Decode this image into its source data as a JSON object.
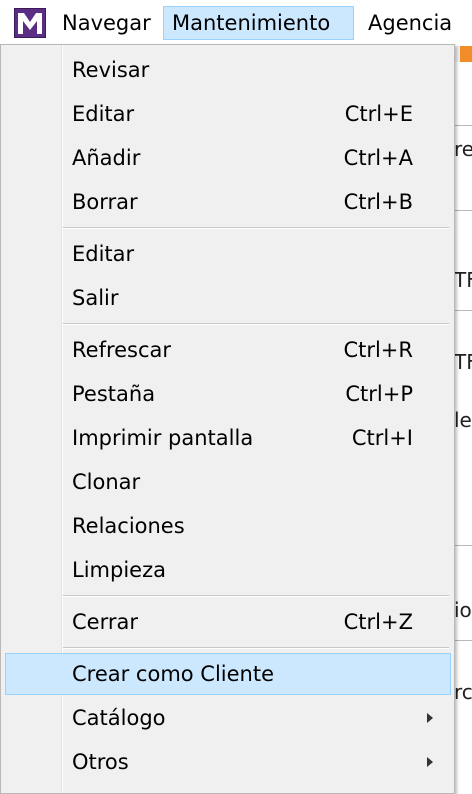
{
  "menubar": {
    "items": [
      {
        "label": "Navegar"
      },
      {
        "label": "Mantenimiento"
      },
      {
        "label": "Agencia"
      }
    ]
  },
  "dropdown": {
    "groups": [
      [
        {
          "label": "Revisar",
          "shortcut": ""
        },
        {
          "label": "Editar",
          "shortcut": "Ctrl+E"
        },
        {
          "label": "Añadir",
          "shortcut": "Ctrl+A"
        },
        {
          "label": "Borrar",
          "shortcut": "Ctrl+B"
        }
      ],
      [
        {
          "label": "Editar",
          "shortcut": ""
        },
        {
          "label": "Salir",
          "shortcut": ""
        }
      ],
      [
        {
          "label": "Refrescar",
          "shortcut": "Ctrl+R"
        },
        {
          "label": "Pestaña",
          "shortcut": "Ctrl+P"
        },
        {
          "label": "Imprimir pantalla",
          "shortcut": "Ctrl+I"
        },
        {
          "label": "Clonar",
          "shortcut": ""
        },
        {
          "label": "Relaciones",
          "shortcut": ""
        },
        {
          "label": "Limpieza",
          "shortcut": ""
        }
      ],
      [
        {
          "label": "Cerrar",
          "shortcut": "Ctrl+Z"
        }
      ],
      [
        {
          "label": "Crear como Cliente",
          "shortcut": "",
          "highlighted": true
        },
        {
          "label": "Catálogo",
          "submenu": true
        },
        {
          "label": "Otros",
          "submenu": true
        }
      ]
    ]
  },
  "background": {
    "fragments": [
      "re",
      "TF",
      "TF",
      "le",
      "io",
      "rc"
    ]
  },
  "colors": {
    "highlight_bg": "#cce8ff",
    "highlight_border": "#99d1ff",
    "menu_bg": "#f0f0f0",
    "accent": "#f28c28",
    "app_icon": "#5b2d83"
  }
}
